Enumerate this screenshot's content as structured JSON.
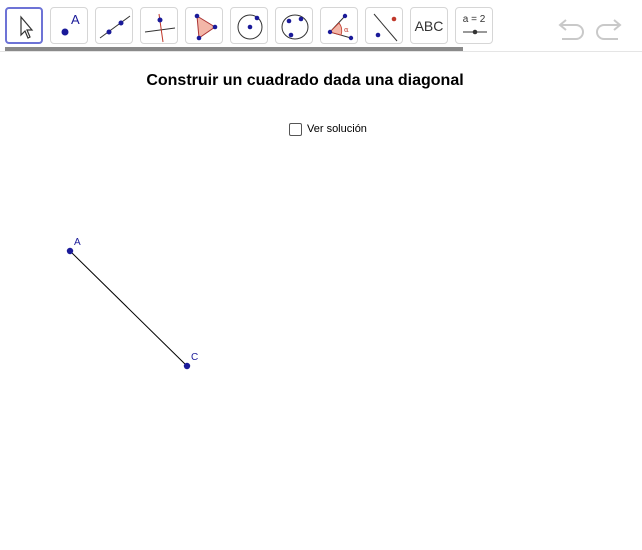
{
  "toolbar": {
    "tools": [
      {
        "name": "move-tool"
      },
      {
        "name": "point-tool",
        "label": "A"
      },
      {
        "name": "line-tool"
      },
      {
        "name": "perpendicular-line-tool"
      },
      {
        "name": "polygon-tool"
      },
      {
        "name": "circle-center-point-tool"
      },
      {
        "name": "circle-three-points-tool"
      },
      {
        "name": "angle-tool"
      },
      {
        "name": "reflect-tool"
      },
      {
        "name": "text-tool",
        "label": "ABC"
      },
      {
        "name": "slider-tool",
        "label": "a = 2"
      }
    ],
    "undo_icon": "undo-icon",
    "redo_icon": "redo-icon"
  },
  "page": {
    "title": "Construir un cuadrado dada una diagonal",
    "checkbox_label": "Ver solución",
    "checkbox_checked": false
  },
  "construction": {
    "point_a_label": "A",
    "point_c_label": "C",
    "point_color": "#1a1a99",
    "segment_color": "#000000"
  }
}
